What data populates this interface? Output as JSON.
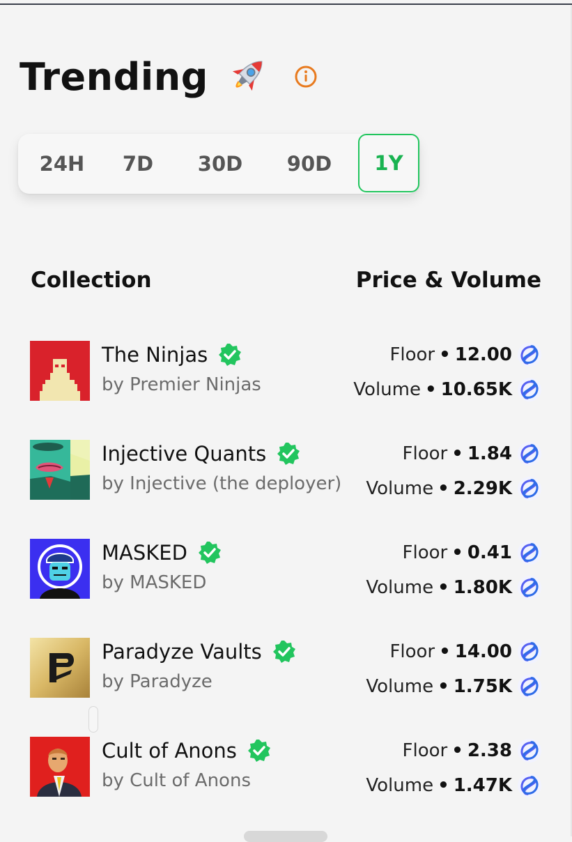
{
  "page": {
    "title": "Trending"
  },
  "tabs": [
    {
      "label": "24H",
      "active": false
    },
    {
      "label": "7D",
      "active": false
    },
    {
      "label": "30D",
      "active": false
    },
    {
      "label": "90D",
      "active": false
    },
    {
      "label": "1Y",
      "active": true
    }
  ],
  "table": {
    "col_collection": "Collection",
    "col_price_volume": "Price & Volume",
    "floor_label": "Floor",
    "volume_label": "Volume",
    "separator": "•"
  },
  "collections": [
    {
      "name": "The Ninjas",
      "creator": "by Premier Ninjas",
      "floor": "12.00",
      "volume": "10.65K",
      "verified": true
    },
    {
      "name": "Injective Quants",
      "creator": "by Injective (the deployer)",
      "floor": "1.84",
      "volume": "2.29K",
      "verified": true
    },
    {
      "name": "MASKED",
      "creator": "by MASKED",
      "floor": "0.41",
      "volume": "1.80K",
      "verified": true
    },
    {
      "name": "Paradyze Vaults",
      "creator": "by Paradyze",
      "floor": "14.00",
      "volume": "1.75K",
      "verified": true
    },
    {
      "name": "Cult of Anons",
      "creator": "by Cult of Anons",
      "floor": "2.38",
      "volume": "1.47K",
      "verified": true
    }
  ],
  "icons": {
    "title_emoji": "rocket-icon",
    "info": "info-icon",
    "verified": "verified-badge-icon",
    "currency": "injective-token-icon"
  },
  "colors": {
    "accent_green": "#21c55d",
    "info_orange": "#e87a1e",
    "token_blue": "#4b57f0",
    "background": "#f4f4f4"
  }
}
